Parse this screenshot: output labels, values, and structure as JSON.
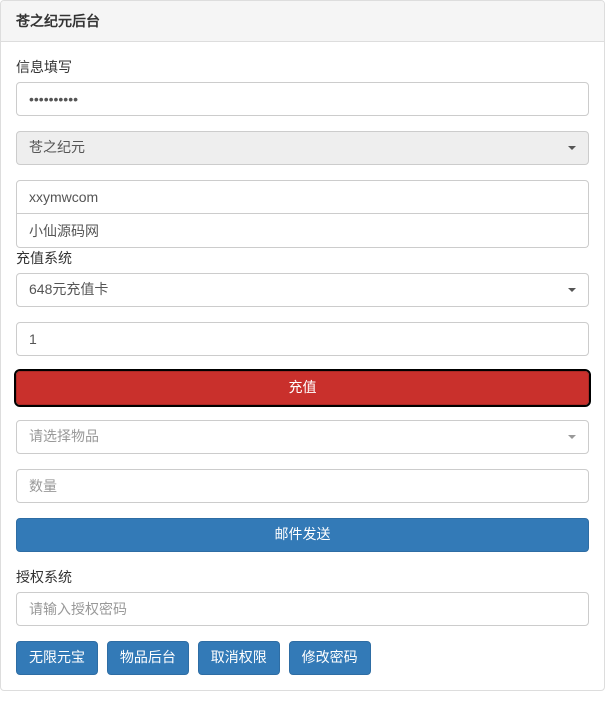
{
  "panel": {
    "title": "苍之纪元后台"
  },
  "info": {
    "label": "信息填写",
    "password_value": "••••••••••",
    "game_select": "苍之纪元",
    "account_value": "xxymwcom",
    "nickname_value": "小仙源码网"
  },
  "recharge": {
    "label": "充值系统",
    "card_select": "648元充值卡",
    "amount_value": "1",
    "submit_label": "充值",
    "item_select_placeholder": "请选择物品",
    "quantity_placeholder": "数量",
    "mail_button": "邮件发送"
  },
  "auth": {
    "label": "授权系统",
    "password_placeholder": "请输入授权密码"
  },
  "buttons": {
    "unlimited": "无限元宝",
    "item_admin": "物品后台",
    "revoke": "取消权限",
    "change_pwd": "修改密码"
  }
}
